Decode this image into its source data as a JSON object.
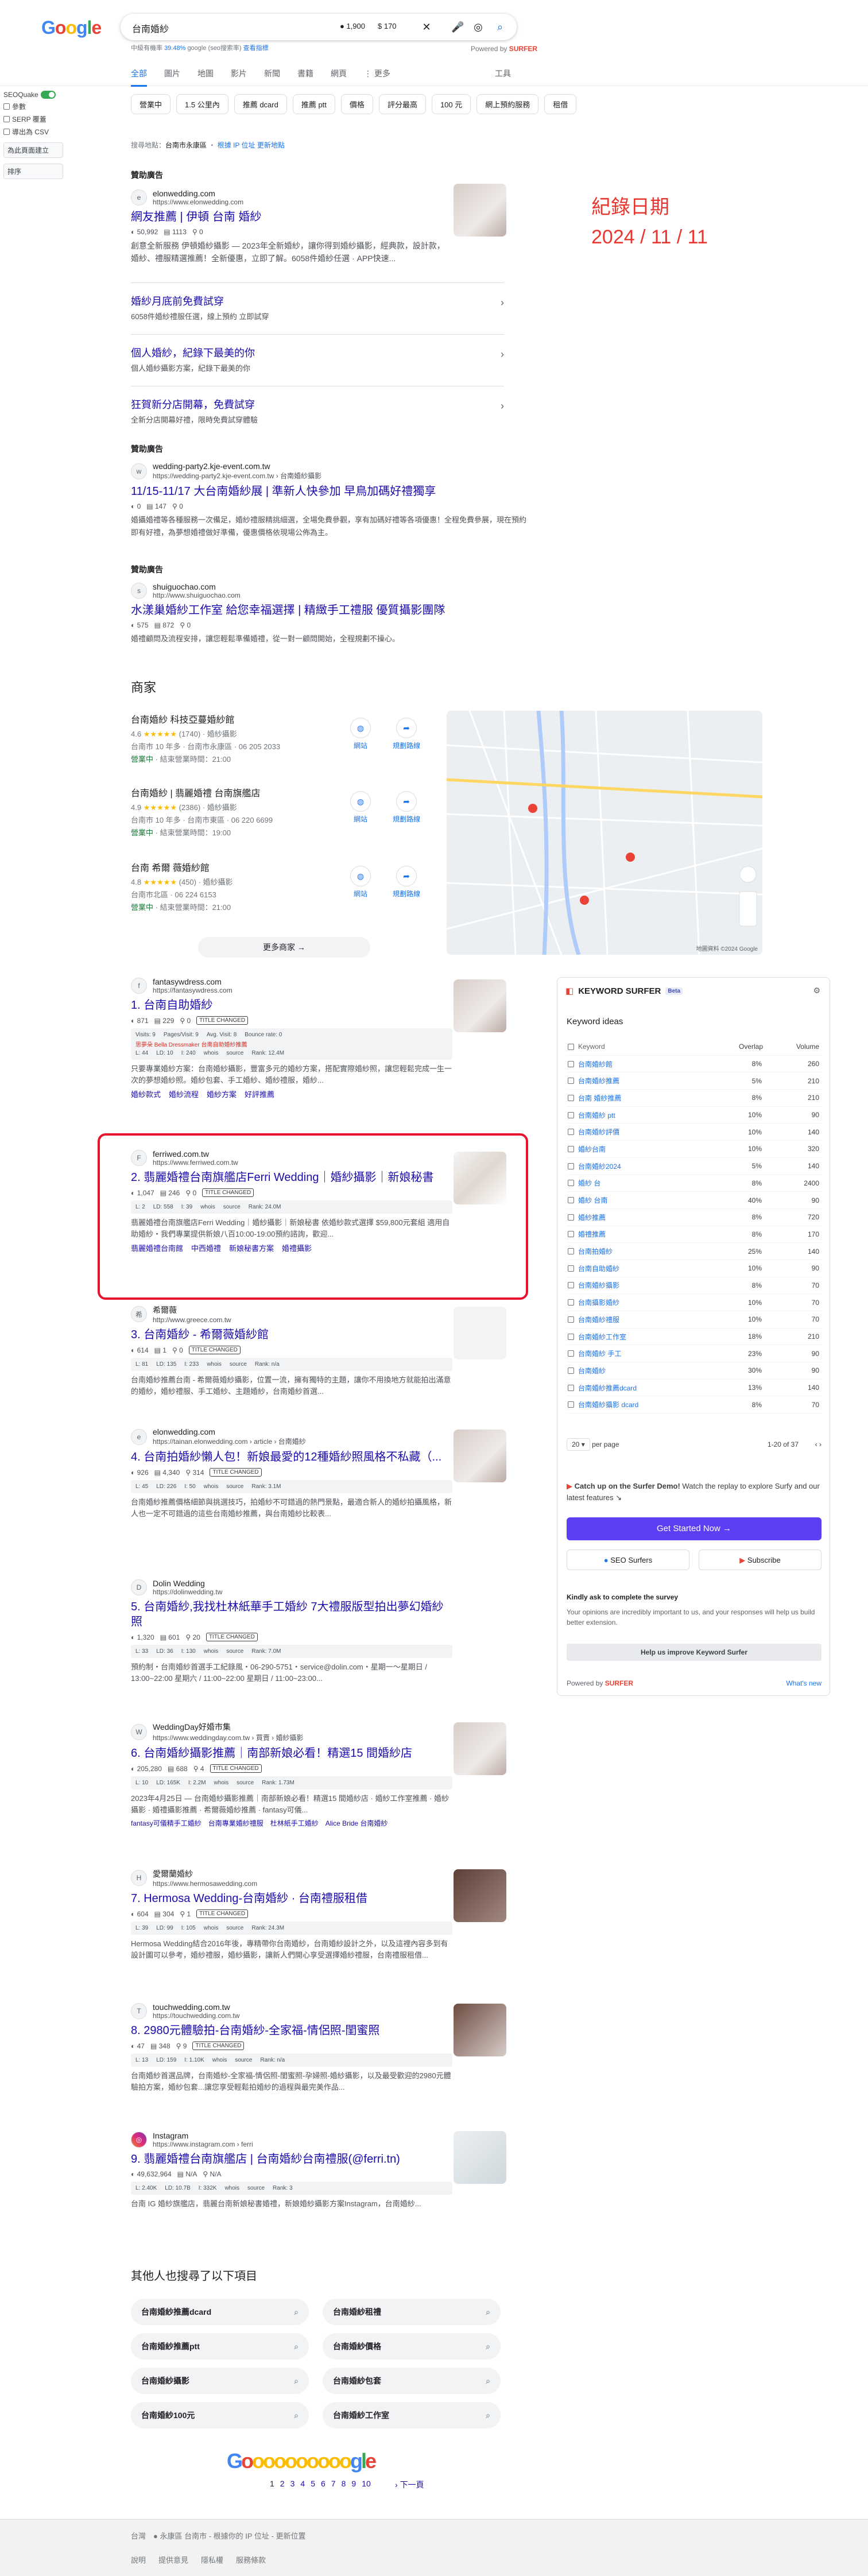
{
  "search": {
    "query": "台南婚紗",
    "volume": "1,900",
    "cpc": "170",
    "kw_line_prefix": "中級有機率",
    "kw_line_value": "39.48%",
    "kw_line_suffix": "google (seo搜索率)",
    "kw_line_link": "查看指標"
  },
  "powered_by": {
    "label": "Powered by",
    "brand": "SURFER"
  },
  "tabs": [
    "全部",
    "圖片",
    "地圖",
    "影片",
    "新聞",
    "書籍",
    "網頁",
    "⋮ 更多"
  ],
  "tools_label": "工具",
  "chips": [
    "營業中",
    "1.5 公里內",
    "推薦 dcard",
    "推薦 ptt",
    "價格",
    "評分最高",
    "100 元",
    "網上預約服務",
    "租借"
  ],
  "seo_panel": {
    "label": "SEOQuake",
    "items": [
      "參數",
      "SERP 覆蓋",
      "導出為 CSV"
    ],
    "select1": "為此頁面建立",
    "select2": "排序"
  },
  "location": {
    "prefix": "搜尋地點：",
    "place": "台南市永康區",
    "link": "根據 IP 位址",
    "sep": "・",
    "link2": "更新地點"
  },
  "annotation": {
    "line1": "紀錄日期",
    "line2": "2024 / 11 / 11"
  },
  "ads": [
    {
      "label": "贊助廣告",
      "site": "elonwedding.com",
      "url": "https://www.elonwedding.com",
      "title": "網友推薦 | 伊頓 台南 婚紗",
      "metrics": [
        "50,992",
        "1113",
        "0"
      ],
      "snippet": "創意全新服務 伊頓婚紗攝影 — 2023年全新婚紗，讓你得到婚紗攝影，經典款，設計款，婚紗、禮服精選推薦！全新優惠，立即了解。6058件婚紗任選 · APP快速..."
    },
    {
      "label": "贊助廣告",
      "site": "wedding-party2.kje-event.com.tw",
      "url": "https://wedding-party2.kje-event.com.tw › 台南婚紗攝影",
      "title": "11/15-11/17 大台南婚紗展 | 準新人快參加 早鳥加碼好禮獨享",
      "metrics": [
        "0",
        "147",
        "0"
      ],
      "snippet": "婚攝婚禮等各種服務一次備足，婚紗禮服精挑細選，全場免費參觀，享有加碼好禮等各項優惠！全程免費參展，現在預約即有好禮，為夢想婚禮做好準備，優惠價格依現場公佈為主。"
    },
    {
      "label": "贊助廣告",
      "site": "shuiguochao.com",
      "url": "http://www.shuiguochao.com",
      "title": "水漾巢婚紗工作室 給您幸福選擇 | 精緻手工禮服 優質攝影團隊",
      "metrics": [
        "575",
        "872",
        "0"
      ],
      "snippet": "婚禮顧問及流程安排，讓您輕鬆準備婚禮，從一對一顧問開始，全程規劃不操心。"
    }
  ],
  "sitelinks": [
    {
      "title": "婚紗月底前免費試穿",
      "desc": "6058件婚紗禮服任選，線上預約 立即試穿"
    },
    {
      "title": "個人婚紗，紀錄下最美的你",
      "desc": "個人婚紗攝影方案，紀錄下最美的你"
    },
    {
      "title": "狂賀新分店開幕，免費試穿",
      "desc": "全新分店開幕好禮，限時免費試穿體驗"
    }
  ],
  "businesses": {
    "title": "商家",
    "items": [
      {
        "name": "台南婚紗 科技亞蔓婚紗館",
        "rating": "4.6",
        "stars": "★★★★★",
        "count": "(1740)",
        "type": "婚紗攝影",
        "line2": "台南市 10 年多 · 台南市永康區 · 06 205 2033",
        "open": "營業中",
        "close": " · 結束營業時間：21:00"
      },
      {
        "name": "台南婚紗 | 翡麗婚禮 台南旗艦店",
        "rating": "4.9",
        "stars": "★★★★★",
        "count": "(2386)",
        "type": "婚紗攝影",
        "line2": "台南市 10 年多 · 台南市東區 · 06 220 6699",
        "open": "營業中",
        "close": " · 結束營業時間：19:00"
      },
      {
        "name": "台南 希爾 薇婚紗館",
        "rating": "4.8",
        "stars": "★★★★★",
        "count": "(450)",
        "type": "婚紗攝影",
        "line2": "台南市北區 · 06 224 6153",
        "open": "營業中",
        "close": " · 結束營業時間：21:00"
      }
    ],
    "btn_web": "網站",
    "btn_route": "規劃路線",
    "more": "更多商家  →",
    "map_attr": "地圖資料 ©2024 Google"
  },
  "results": [
    {
      "site": "fantasywdress.com",
      "url": "https://fantasywdress.com",
      "title": "1. 台南自助婚紗",
      "metrics": [
        "871",
        "229",
        "0"
      ],
      "title_changed": "TITLE CHANGED",
      "minibar": [
        "Visits: 9",
        "Pages/Visit: 9",
        "Avg. Visit: 8",
        "Bounce rate: 0"
      ],
      "minibar2": "思夢朵 Bella Dressmaker 台南自助婚紗推薦",
      "minibar3": [
        "L: 44",
        "LD: 10",
        "I: 240",
        "whois",
        "source",
        "Rank: 12.4M"
      ],
      "snippet": "只要專業婚紗方案：台南婚紗攝影，豐富多元的婚紗方案，搭配實際婚紗照，讓您輕鬆完成一生一次的夢想婚紗照。婚紗包套、手工婚紗、婚紗禮服，婚紗...",
      "links": [
        "婚紗款式",
        "婚紗流程",
        "婚紗方案",
        "好評推薦"
      ]
    },
    {
      "site": "ferriwed.com.tw",
      "url": "https://www.ferriwed.com.tw",
      "title": "2. 翡麗婚禮台南旗艦店Ferri Wedding｜婚紗攝影｜新娘秘書",
      "metrics": [
        "1,047",
        "246",
        "0"
      ],
      "title_changed": "TITLE CHANGED",
      "minibar3": [
        "L: 2",
        "LD: 558",
        "I: 39",
        "whois",
        "source",
        "Rank: 24.0M"
      ],
      "snippet": "翡麗婚禮台南旗艦店Ferri Wedding｜婚紗攝影｜新娘秘書 依婚紗款式選擇 $59,800元套組 適用自助婚紗・我們專業提供新娘八百10:00-19:00預約諮詢，歡迎...",
      "links": [
        "翡麗婚禮台南館",
        "中西婚禮",
        "新娘秘書方案",
        "婚禮攝影"
      ]
    },
    {
      "site": "希爾薇",
      "url": "http://www.greece.com.tw",
      "title": "3. 台南婚紗 - 希爾薇婚紗館",
      "metrics": [
        "614",
        "1",
        "0"
      ],
      "title_changed": "TITLE CHANGED",
      "minibar3": [
        "L: 81",
        "LD: 135",
        "I: 233",
        "whois",
        "source",
        "Rank: n/a"
      ],
      "snippet": "台南婚紗推薦台南 - 希爾薇婚紗攝影，位置一流，擁有獨特的主題，讓你不用換地方就能拍出滿意的婚紗，婚紗禮服、手工婚紗、主題婚紗，台南婚紗首選..."
    },
    {
      "site": "elonwedding.com",
      "url": "https://tainan.elonwedding.com › article › 台南婚紗",
      "title": "4. 台南拍婚紗懶人包！新娘最愛的12種婚紗照風格不私藏（...",
      "metrics": [
        "926",
        "4,340",
        "314"
      ],
      "title_changed": "TITLE CHANGED",
      "minibar3": [
        "L: 45",
        "LD: 226",
        "I: 50",
        "whois",
        "source",
        "Rank: 3.1M"
      ],
      "snippet": "台南婚紗推薦價格細節與挑選技巧，拍婚紗不可錯過的熱門景點，最適合新人的婚紗拍攝風格，新人也一定不可錯過的這些台南婚紗推薦，與台南婚紗比較表..."
    },
    {
      "site": "Dolin Wedding",
      "url": "https://dolinwedding.tw",
      "title": "5. 台南婚紗,我找杜林紙華手工婚紗 7大禮服版型拍出夢幻婚紗照",
      "metrics": [
        "1,320",
        "601",
        "20"
      ],
      "title_changed": "TITLE CHANGED",
      "minibar3": [
        "L: 33",
        "LD: 36",
        "I: 130",
        "whois",
        "source",
        "Rank: 7.0M"
      ],
      "snippet": "預約制・台南婚紗首選手工紀錄風・06-290-5751・service@dolin.com・星期一～星期日 / 13:00~22:00 星期六 / 11:00~22:00 星期日 / 11:00~23:00..."
    },
    {
      "site": "WeddingDay好婚市集",
      "url": "https://www.weddingday.com.tw › 買賣 › 婚紗攝影",
      "title": "6. 台南婚紗攝影推薦｜南部新娘必看！精選15 間婚紗店",
      "metrics": [
        "205,280",
        "688",
        "4"
      ],
      "title_changed": "TITLE CHANGED",
      "minibar3": [
        "L: 10",
        "LD: 165K",
        "I: 2.2M",
        "whois",
        "source",
        "Rank: 1.73M"
      ],
      "snippet": "2023年4月25日 — 台南婚紗攝影推薦｜南部新娘必看！精選15 間婚紗店 · 婚紗工作室推薦 · 婚紗攝影 · 婚禮攝影推薦 · 希爾薇婚紗推薦 · fantasy可儀...",
      "links": [
        "fantasy可儀精手工婚紗",
        "台南專業婚紗禮服",
        "杜林紙手工婚紗",
        "Alice Bride 台南婚紗"
      ]
    },
    {
      "site": "愛爾蘭婚紗",
      "url": "https://www.hermosawedding.com",
      "title": "7. Hermosa Wedding-台南婚紗 · 台南禮服租借",
      "metrics": [
        "604",
        "304",
        "1"
      ],
      "title_changed": "TITLE CHANGED",
      "minibar3": [
        "L: 39",
        "LD: 99",
        "I: 105",
        "whois",
        "source",
        "Rank: 24.3M"
      ],
      "snippet": "Hermosa Wedding結合2016年後，專精帶你台南婚紗，台南婚紗設計之外，以及這裡內容多到有設計圖可以參考，婚紗禮服，婚紗攝影，讓新人們開心享受選擇婚紗禮服，台南禮服租借..."
    },
    {
      "site": "touchwedding.com.tw",
      "url": "https://touchwedding.com.tw",
      "title": "8. 2980元體驗拍-台南婚紗-全家福-情侶照-閨蜜照",
      "metrics": [
        "47",
        "348",
        "9"
      ],
      "title_changed": "TITLE CHANGED",
      "minibar3": [
        "L: 13",
        "LD: 159",
        "I: 1.10K",
        "whois",
        "source",
        "Rank: n/a"
      ],
      "snippet": "台南婚紗首選品牌，台南婚紗-全家福-情侶照-閨蜜照-孕婦照-婚紗攝影，以及最受歡迎的2980元體驗拍方案，婚紗包套...讓您享受輕鬆拍婚紗的過程與最完美作品..."
    },
    {
      "site": "Instagram",
      "url": "https://www.instagram.com › ferri",
      "title": "9. 翡麗婚禮台南旗艦店 | 台南婚紗台南禮服(@ferri.tn)",
      "metrics": [
        "49,632,964",
        "N/A",
        "N/A"
      ],
      "minibar3": [
        "L: 2.40K",
        "LD: 10.7B",
        "I: 332K",
        "whois",
        "source",
        "Rank: 3"
      ],
      "snippet": "台南 IG 婚紗旗艦店，翡麗台南新娘秘書婚禮，新娘婚紗攝影方案Instagram，台南婚紗..."
    }
  ],
  "keyword_surfer": {
    "title": "KEYWORD SURFER",
    "badge": "Beta",
    "subtitle": "Keyword ideas",
    "col_keyword": "Keyword",
    "col_overlap": "Overlap",
    "col_volume": "Volume",
    "rows": [
      {
        "kw": "台南婚紗館",
        "ov": "8%",
        "vol": "260"
      },
      {
        "kw": "台南婚紗推薦",
        "ov": "5%",
        "vol": "210"
      },
      {
        "kw": "台南 婚紗推薦",
        "ov": "8%",
        "vol": "210"
      },
      {
        "kw": "台南婚紗 ptt",
        "ov": "10%",
        "vol": "90"
      },
      {
        "kw": "台南婚紗評價",
        "ov": "10%",
        "vol": "140"
      },
      {
        "kw": "婚紗台南",
        "ov": "10%",
        "vol": "320"
      },
      {
        "kw": "台南婚紗2024",
        "ov": "5%",
        "vol": "140"
      },
      {
        "kw": "婚紗 台",
        "ov": "8%",
        "vol": "2400"
      },
      {
        "kw": "婚紗 台南",
        "ov": "40%",
        "vol": "90"
      },
      {
        "kw": "婚紗推薦",
        "ov": "8%",
        "vol": "720"
      },
      {
        "kw": "婚禮推薦",
        "ov": "8%",
        "vol": "170"
      },
      {
        "kw": "台南拍婚紗",
        "ov": "25%",
        "vol": "140"
      },
      {
        "kw": "台南自助婚紗",
        "ov": "10%",
        "vol": "90"
      },
      {
        "kw": "台南婚紗攝影",
        "ov": "8%",
        "vol": "70"
      },
      {
        "kw": "台南攝影婚紗",
        "ov": "10%",
        "vol": "70"
      },
      {
        "kw": "台南婚紗禮服",
        "ov": "10%",
        "vol": "70"
      },
      {
        "kw": "台南婚紗工作室",
        "ov": "18%",
        "vol": "210"
      },
      {
        "kw": "台南婚紗 手工",
        "ov": "23%",
        "vol": "90"
      },
      {
        "kw": "台南婚紗",
        "ov": "30%",
        "vol": "90"
      },
      {
        "kw": "台南婚紗推薦dcard",
        "ov": "13%",
        "vol": "140"
      },
      {
        "kw": "台南婚紗攝影 dcard",
        "ov": "8%",
        "vol": "70"
      }
    ],
    "per_page": "20",
    "per_page_label": "per page",
    "range": "1-20 of 37",
    "cta_bold": "Catch up on the Surfer Demo!",
    "cta_text": " Watch the replay to explore Surfy and our latest features ↘",
    "start_btn": "Get Started Now →",
    "seo_surfers": "SEO Surfers",
    "subscribe": "Subscribe",
    "survey_title": "Kindly ask to complete the survey",
    "survey_text": "Your opinions are incredibly important to us, and your responses will help us build better extension.",
    "help_btn": "Help us improve Keyword Surfer",
    "powered": "Powered by",
    "powered_brand": "SURFER",
    "whats_new": "What's new"
  },
  "related": {
    "title": "其他人也搜尋了以下項目",
    "items": [
      "台南婚紗推薦dcard",
      "台南婚紗租禮",
      "台南婚紗推薦ptt",
      "台南婚紗價格",
      "台南婚紗攝影",
      "台南婚紗包套",
      "台南婚紗100元",
      "台南婚紗工作室"
    ]
  },
  "pagination": {
    "pages": [
      "1",
      "2",
      "3",
      "4",
      "5",
      "6",
      "7",
      "8",
      "9",
      "10"
    ],
    "next": "下一頁"
  },
  "footer": {
    "country": "台灣",
    "line1": "● 永康區 台南市 - 根據你的 IP 位址 - 更新位置",
    "links": [
      "說明",
      "提供意見",
      "隱私權",
      "服務條款"
    ]
  }
}
